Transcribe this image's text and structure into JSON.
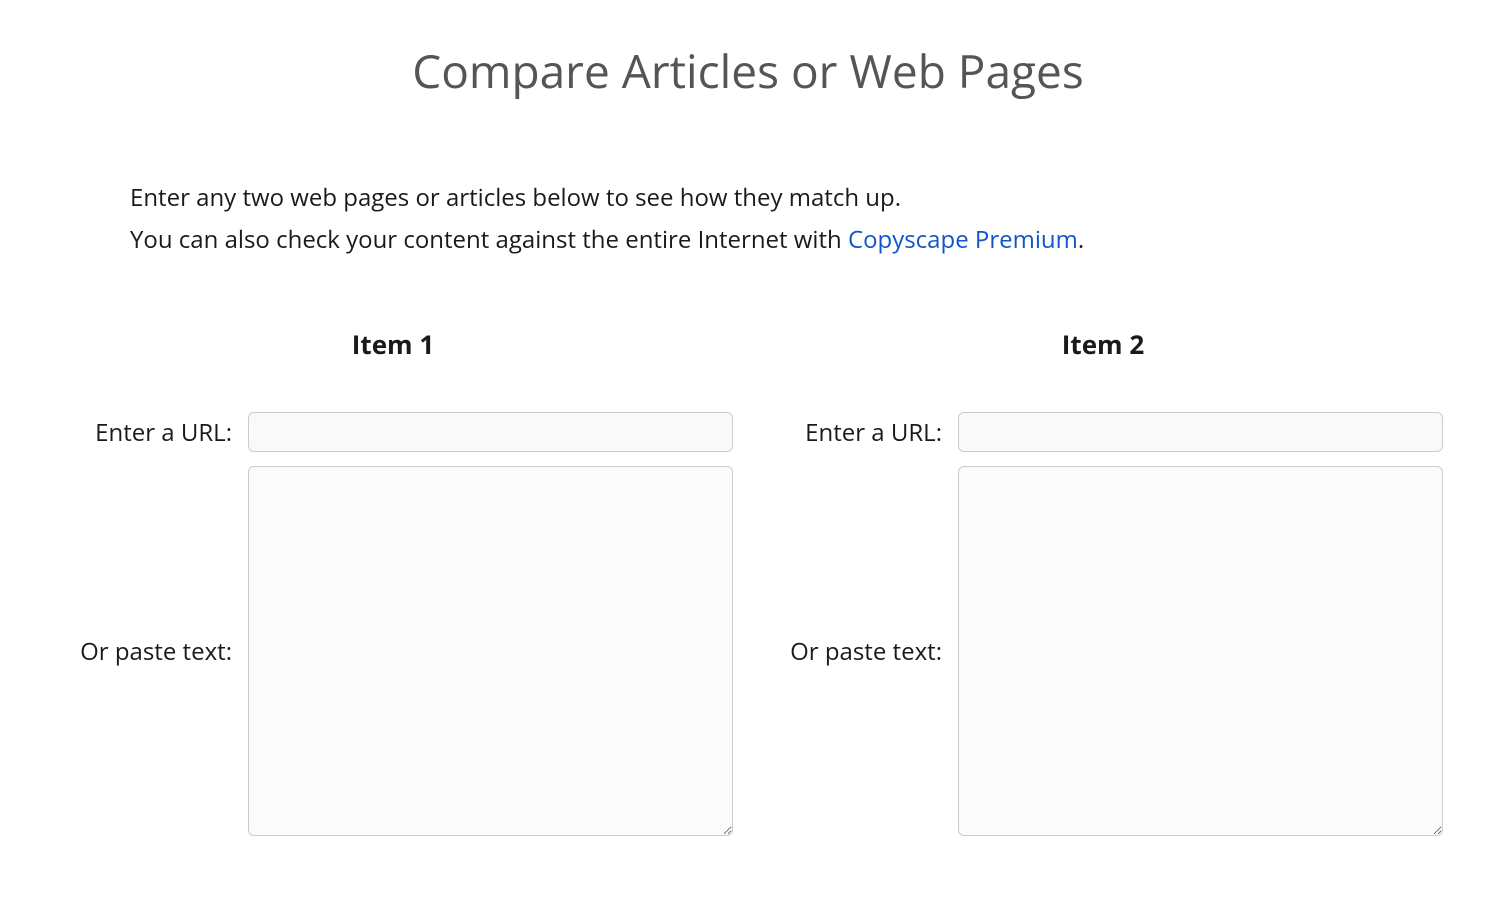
{
  "title": "Compare Articles or Web Pages",
  "intro": {
    "line1": "Enter any two web pages or articles below to see how they match up.",
    "line2_prefix": "You can also check your content against the entire Internet with ",
    "line2_link": "Copyscape Premium",
    "line2_suffix": "."
  },
  "items": {
    "item1": {
      "heading": "Item 1",
      "url_label": "Enter a URL:",
      "text_label": "Or paste text:",
      "url_value": "",
      "text_value": ""
    },
    "item2": {
      "heading": "Item 2",
      "url_label": "Enter a URL:",
      "text_label": "Or paste text:",
      "url_value": "",
      "text_value": ""
    }
  }
}
